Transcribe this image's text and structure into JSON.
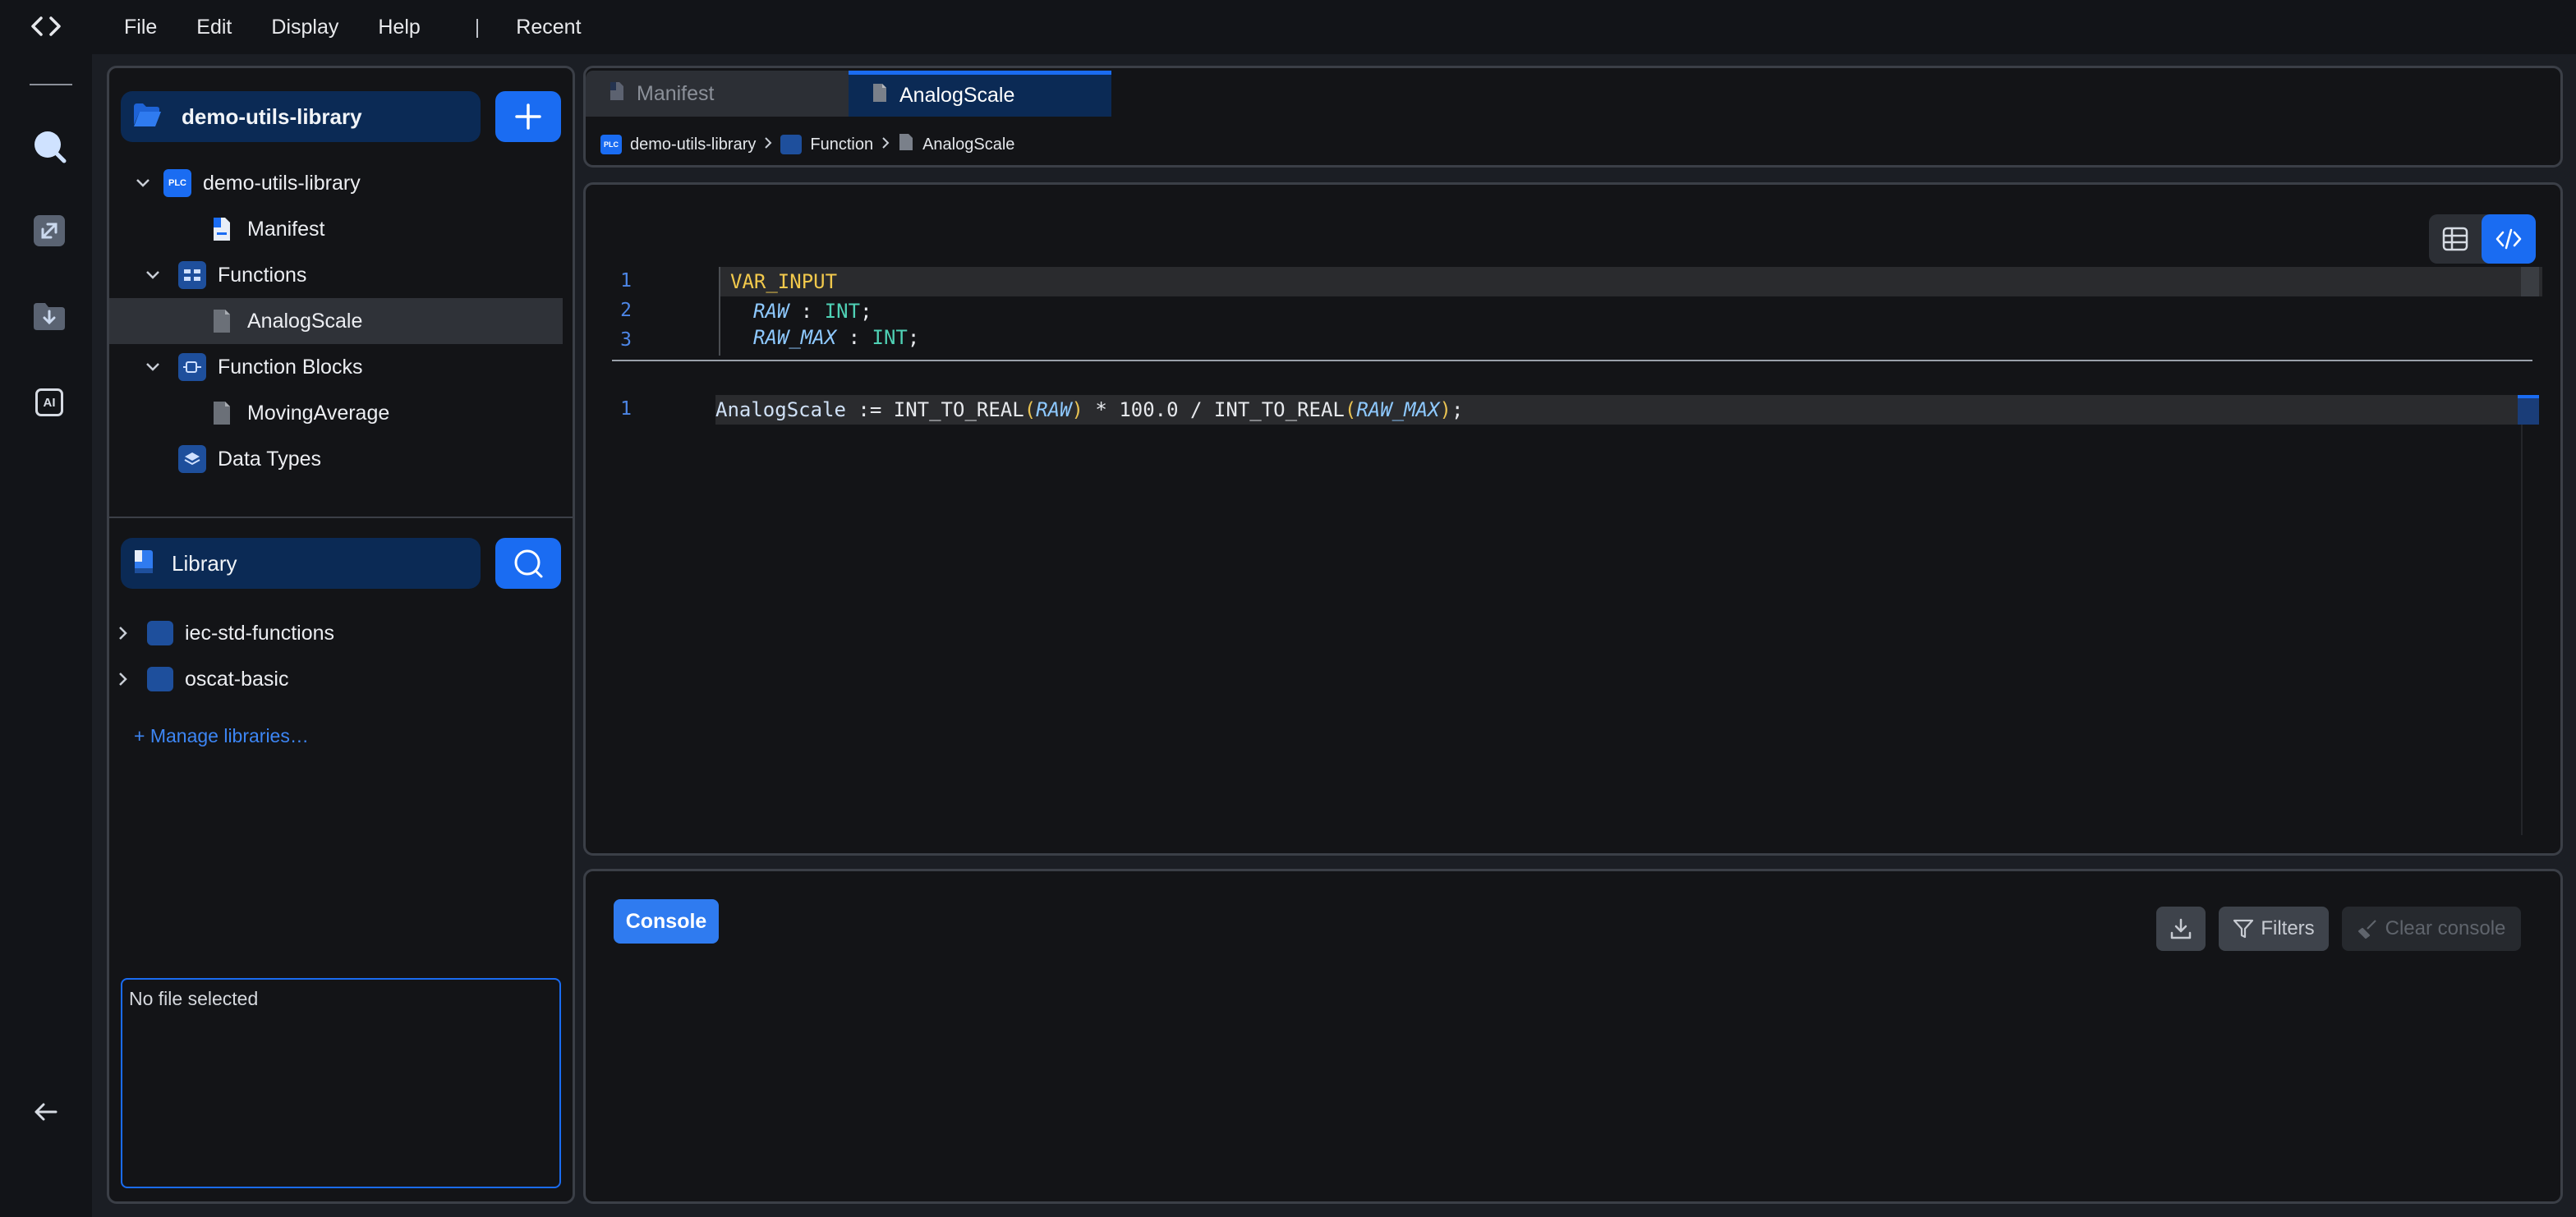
{
  "menu": {
    "file": "File",
    "edit": "Edit",
    "display": "Display",
    "help": "Help",
    "separator": "|",
    "recent": "Recent"
  },
  "project": {
    "name": "demo-utils-library",
    "tree": {
      "root": "demo-utils-library",
      "root_badge": "PLC",
      "manifest": "Manifest",
      "functions": "Functions",
      "function_item": "AnalogScale",
      "function_blocks": "Function Blocks",
      "function_block_item": "MovingAverage",
      "data_types": "Data Types"
    }
  },
  "library": {
    "title": "Library",
    "items": [
      "iec-std-functions",
      "oscat-basic"
    ],
    "manage_link": "+ Manage libraries…"
  },
  "file_info": {
    "placeholder": "No file selected"
  },
  "tabs": [
    {
      "label": "Manifest",
      "active": false
    },
    {
      "label": "AnalogScale",
      "active": true
    }
  ],
  "breadcrumb": {
    "project": "demo-utils-library",
    "category": "Function",
    "file": "AnalogScale",
    "badge": "PLC"
  },
  "editor": {
    "var_block": [
      {
        "num": "1",
        "text": "VAR_INPUT"
      },
      {
        "num": "2",
        "name": "RAW",
        "sep": " : ",
        "type": "INT",
        "end": ";"
      },
      {
        "num": "3",
        "name": "RAW_MAX",
        "sep": " : ",
        "type": "INT",
        "end": ";"
      }
    ],
    "body": {
      "num": "1",
      "lhs": "AnalogScale",
      "assign": " := ",
      "fn1": "INT_TO_REAL",
      "arg1": "RAW",
      "mid": " * 100.0 / ",
      "fn2": "INT_TO_REAL",
      "arg2": "RAW_MAX",
      "end": ";"
    }
  },
  "console": {
    "tab": "Console",
    "filters": "Filters",
    "clear": "Clear console"
  },
  "rail": {
    "ai_label": "AI"
  },
  "colors": {
    "accent": "#1a6cf2",
    "keyword": "#f2c94c",
    "type": "#4fd1b5",
    "variable": "#8ec9ff",
    "paren": "#e8c252"
  }
}
